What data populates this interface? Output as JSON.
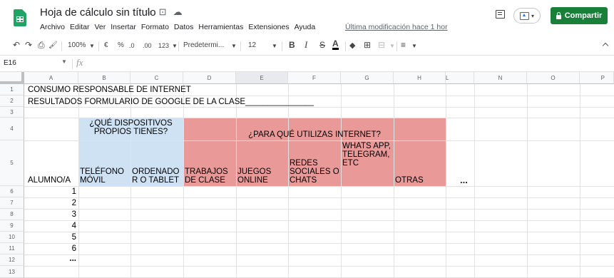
{
  "header": {
    "doc_title": "Hoja de cálculo sin título",
    "title_icons": [
      "☆",
      "⊡",
      "☁"
    ],
    "menus": [
      "Archivo",
      "Editar",
      "Ver",
      "Insertar",
      "Formato",
      "Datos",
      "Herramientas",
      "Extensiones",
      "Ayuda"
    ],
    "last_modified": "Última modificación hace 1 hor",
    "share_label": "Compartir",
    "accent_color": "#188038"
  },
  "toolbar": {
    "undo": "↶",
    "redo": "↷",
    "print": "⎙",
    "paint_format": "🖌",
    "zoom": "100%",
    "currency": "€",
    "percent": "%",
    "decrease_decimal": ".0",
    "increase_decimal": ".00",
    "more_formats": "123",
    "font": "Predetermi...",
    "font_size": "12",
    "bold": "B",
    "italic": "I",
    "strike": "S",
    "text_color": "A",
    "fill_color": "◆",
    "borders": "⊞",
    "merge": "⊟",
    "align": "≡"
  },
  "formula_bar": {
    "name_box": "E16",
    "fx": "fx"
  },
  "columns": [
    "A",
    "B",
    "C",
    "D",
    "E",
    "F",
    "G",
    "H",
    "L",
    "N",
    "O",
    "P"
  ],
  "selected_column": "E",
  "rows": [
    "1",
    "2",
    "3",
    "4",
    "5",
    "6",
    "7",
    "8",
    "9",
    "10",
    "11",
    "12",
    "13"
  ],
  "sheet": {
    "a1": "CONSUMO RESPONSABLE DE INTERNET",
    "a2": "RESULTADOS FORMULARIO DE GOOGLE DE LA CLASE_______________",
    "devices_header": "¿QUÉ DISPOSITIVOS PROPIOS TIENES?",
    "uses_header": "¿PARA QUÉ UTILIZAS INTERNET?",
    "alumno": "ALUMNO/A",
    "col_telefono": "TELÉFONO MÓVIL",
    "col_ordenador": "ORDENADO R O TABLET",
    "col_trabajos": "TRABAJOS DE CLASE",
    "col_juegos": "JUEGOS ONLINE",
    "col_redes": "REDES SOCIALES O CHATS",
    "col_whats": "WHATS APP, TELEGRAM, ETC",
    "col_otras": "OTRAS",
    "more": "...",
    "students": [
      "1",
      "2",
      "3",
      "4",
      "5",
      "6"
    ],
    "students_more": "...",
    "blue_fill": "#cfe2f3",
    "red_fill": "#ea9999"
  }
}
